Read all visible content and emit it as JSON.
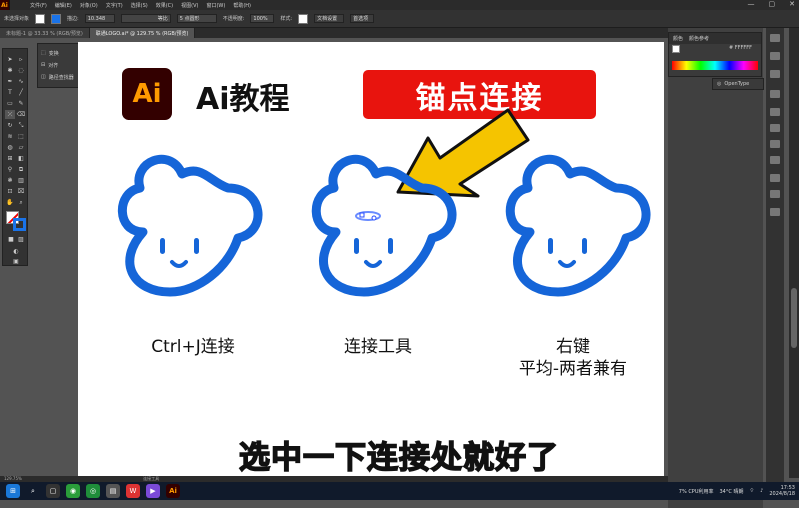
{
  "window": {
    "app_icon": "Ai",
    "menu": [
      "文件(F)",
      "编辑(E)",
      "对象(O)",
      "文字(T)",
      "选择(S)",
      "效果(C)",
      "视图(V)",
      "窗口(W)",
      "帮助(H)"
    ],
    "controls": [
      "—",
      "▢",
      "✕"
    ]
  },
  "control_bar": {
    "selection_label": "未选择对象",
    "stroke_label": "描边:",
    "stroke_value": "10.348",
    "stroke_style": "等比",
    "brush_label": "5 点圆形",
    "opacity_label": "不透明度:",
    "opacity_value": "100%",
    "style_label": "样式:",
    "doc_setup": "文档设置",
    "prefs": "首选项"
  },
  "tabs": [
    {
      "label": "未标题-1 @ 33.33 % (RGB/预览)",
      "active": false
    },
    {
      "label": "联通LOGO.ai* @ 129.75 % (RGB/预览)",
      "active": true
    }
  ],
  "popup_menu": [
    "变换",
    "对齐",
    "路径查找器"
  ],
  "color_panel": {
    "tabs": [
      "颜色",
      "颜色参考"
    ],
    "hex": "FFFFFF"
  },
  "opentype_panel": {
    "label": "OpenType"
  },
  "canvas": {
    "badge": "Ai",
    "title": "Ai教程",
    "banner": "锚点连接",
    "captions": [
      {
        "lines": [
          "Ctrl+J连接"
        ]
      },
      {
        "lines": [
          "连接工具"
        ]
      },
      {
        "lines": [
          "右键",
          "平均-两者兼有"
        ]
      }
    ],
    "subtitle": "选中一下连接处就好了",
    "colors": {
      "cloud": "#1565d8",
      "arrow": "#f5c400",
      "banner": "#e8140e"
    }
  },
  "status_bar": {
    "zoom": "129.75%",
    "tool": "连接工具"
  },
  "taskbar": {
    "weather": "34°C 晴朗",
    "cpu": "7% CPU利用率",
    "time": "17:53",
    "date": "2024/8/18"
  }
}
